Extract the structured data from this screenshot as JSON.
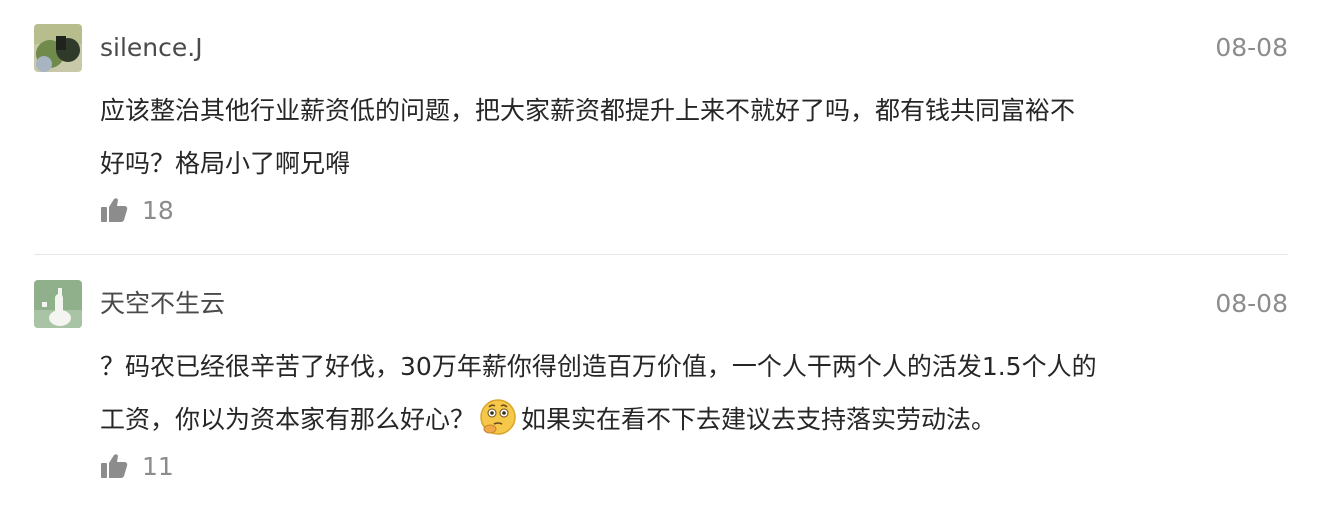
{
  "comments": [
    {
      "username": "silence.J",
      "date": "08-08",
      "content_lines": [
        "应该整治其他行业薪资低的问题，把大家薪资都提升上来不就好了吗，都有钱共同富裕不",
        "好吗？格局小了啊兄嘚"
      ],
      "likes": "18"
    },
    {
      "username": "天空不生云",
      "date": "08-08",
      "content_line1": "？码农已经很辛苦了好伐，30万年薪你得创造百万价值，一个人干两个人的活发1.5个人的",
      "content_line2_before": "工资，你以为资本家有那么好心？",
      "emoji": "thinking-face-emoji",
      "content_line2_after": "如果实在看不下去建议去支持落实劳动法。",
      "likes": "11"
    }
  ],
  "icons": {
    "like": "thumbs-up-icon"
  },
  "colors": {
    "username": "#4a4a4a",
    "date": "#8c8c8c",
    "text": "#262626",
    "icon": "#8c8c8c",
    "divider": "#e6e6e6"
  }
}
